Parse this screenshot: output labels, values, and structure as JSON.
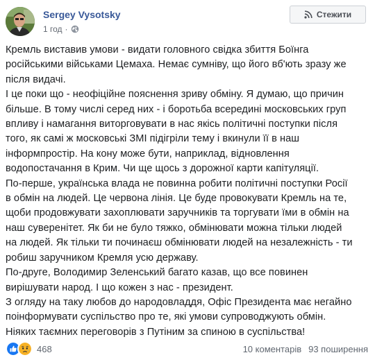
{
  "author": {
    "name": "Sergey Vysotsky",
    "timestamp": "1 год",
    "separator": "·"
  },
  "follow_button": {
    "label": "Стежити",
    "icon": "rss-icon"
  },
  "post": {
    "lines": [
      "Кремль виставив умови - видати головного свідка збиття Боїнга",
      "російськими військами Цемаха. Немає сумніву, що його вб'ють зразу же",
      "після видачі.",
      "І це поки що - неофіційне пояснення зриву обміну. Я думаю, що причин",
      "більше. В тому числі серед них - і боротьба всередині московських груп",
      "впливу і намагання виторговувати в нас якісь політичні поступки після",
      "того, як самі ж московські ЗМІ підігріли тему і вкинули її в наш",
      "інформпростір. На кону може бути, наприклад, відновлення",
      "водопостачання в Крим. Чи ще щось з дорожної карти капітуляції.",
      "По-перше, українська влада не повинна робити політичні поступки Росії",
      "в обмін на людей. Це червона лінія. Це буде провокувати Кремль на те,",
      "щоби продовжувати захоплювати заручників та торгувати їми в обмін на",
      "наш суверенітет. Як би не було тяжко, обмінювати можна тільки людей",
      "на людей. Як тільки ти починаєш обмінювати людей на незалежність - ти",
      "робиш заручником Кремля усю державу.",
      "По-друге, Володимир Зеленський багато казав, що все повинен",
      "вирішувати народ. І що кожен з нас - президент.",
      "З огляду на таку любов до народовладдя, Офіс Президента має негайно",
      "поінформувати суспільство про те, які умови супроводжують обмін.",
      "Ніяких таємних переговорів з Путіним за спиною в суспільства!"
    ]
  },
  "reactions": {
    "icons": [
      "like-icon",
      "sad-icon"
    ],
    "count": "468",
    "colors": {
      "like": "#1877f2",
      "sad": "#f7b125"
    }
  },
  "stats": {
    "comments": "10 коментарів",
    "shares": "93 поширення"
  },
  "colors": {
    "link": "#385898",
    "text": "#1c1e21",
    "muted": "#616770",
    "button_bg": "#f5f6f7",
    "button_border": "#ccd0d5"
  }
}
